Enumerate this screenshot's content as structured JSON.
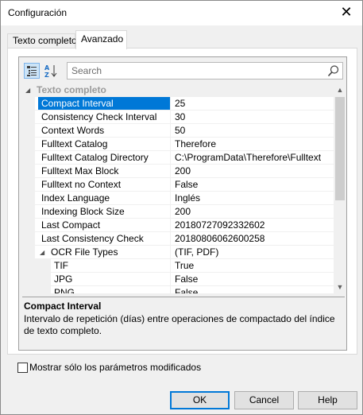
{
  "window": {
    "title": "Configuración",
    "close_symbol": "✕"
  },
  "tabs": [
    {
      "label": "Texto completo",
      "active": false
    },
    {
      "label": "Avanzado",
      "active": true
    }
  ],
  "toolbar": {
    "categorized_icon": "categorized-view-icon",
    "alphabetical_icon": "sort-alphabetical-icon",
    "alpha_top": "A",
    "alpha_bottom": "Z"
  },
  "search": {
    "placeholder": "Search",
    "value": "",
    "icon": "search-icon"
  },
  "grid": {
    "category": {
      "label": "Texto completo",
      "expanded": true,
      "glyph": "◢"
    },
    "rows": [
      {
        "name": "Compact Interval",
        "value": "25",
        "selected": true
      },
      {
        "name": "Consistency Check Interval",
        "value": "30"
      },
      {
        "name": "Context Words",
        "value": "50"
      },
      {
        "name": "Fulltext Catalog",
        "value": "Therefore"
      },
      {
        "name": "Fulltext Catalog Directory",
        "value": "C:\\ProgramData\\Therefore\\Fulltext"
      },
      {
        "name": "Fulltext Max Block",
        "value": "200"
      },
      {
        "name": "Fulltext no Context",
        "value": "False"
      },
      {
        "name": "Index Language",
        "value": "Inglés"
      },
      {
        "name": "Indexing Block Size",
        "value": "200"
      },
      {
        "name": "Last Compact",
        "value": "20180727092332602"
      },
      {
        "name": "Last Consistency Check",
        "value": "20180806062600258"
      },
      {
        "name": "OCR File Types",
        "value": "(TIF, PDF)",
        "expandable": true,
        "glyph": "◢"
      },
      {
        "name": "TIF",
        "value": "True",
        "child": true
      },
      {
        "name": "JPG",
        "value": "False",
        "child": true
      },
      {
        "name": "PNG",
        "value": "False",
        "child": true
      }
    ],
    "scroll_up": "▲",
    "scroll_down": "▼"
  },
  "description": {
    "title": "Compact Interval",
    "text": "Intervalo de repetición (días) entre operaciones de compactado del índice de texto completo."
  },
  "filter_checkbox": {
    "label": "Mostrar sólo los parámetros modificados",
    "checked": false
  },
  "buttons": {
    "ok": "OK",
    "cancel": "Cancel",
    "help": "Help"
  },
  "colors": {
    "selection": "#0078d7",
    "category_text": "#9a9a9a"
  }
}
